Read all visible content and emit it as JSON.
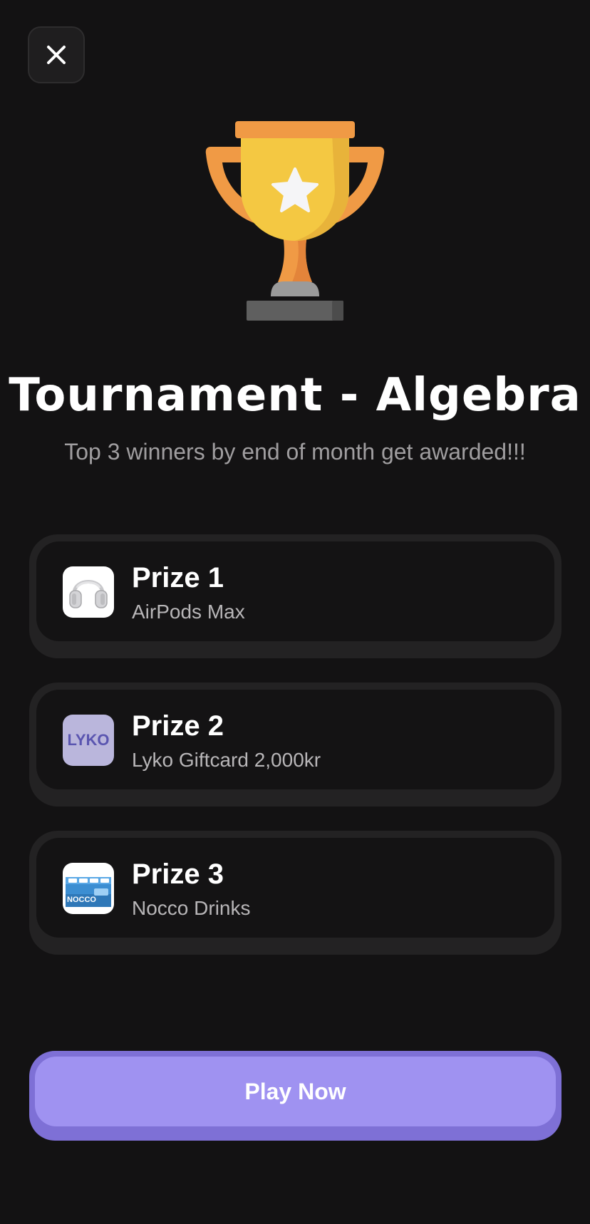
{
  "header": {
    "close_icon": "close-icon"
  },
  "hero": {
    "icon": "trophy-icon",
    "title": "Tournament - Algebra",
    "subtitle": "Top 3 winners by end of month get awarded!!!"
  },
  "prizes": [
    {
      "name": "Prize 1",
      "description": "AirPods Max",
      "icon": "headphones-image"
    },
    {
      "name": "Prize 2",
      "description": "Lyko Giftcard 2,000kr",
      "icon": "lyko-logo",
      "logo_text": "LYKO"
    },
    {
      "name": "Prize 3",
      "description": "Nocco Drinks",
      "icon": "nocco-drinks-image",
      "logo_text": "NOCCO"
    }
  ],
  "cta": {
    "label": "Play Now"
  },
  "colors": {
    "background": "#131213",
    "card": "#232223",
    "card_inner": "#141314",
    "accent": "#9f92f1",
    "accent_shadow": "#7e70d6",
    "trophy_gold": "#f4c842",
    "trophy_orange": "#f09a45"
  }
}
